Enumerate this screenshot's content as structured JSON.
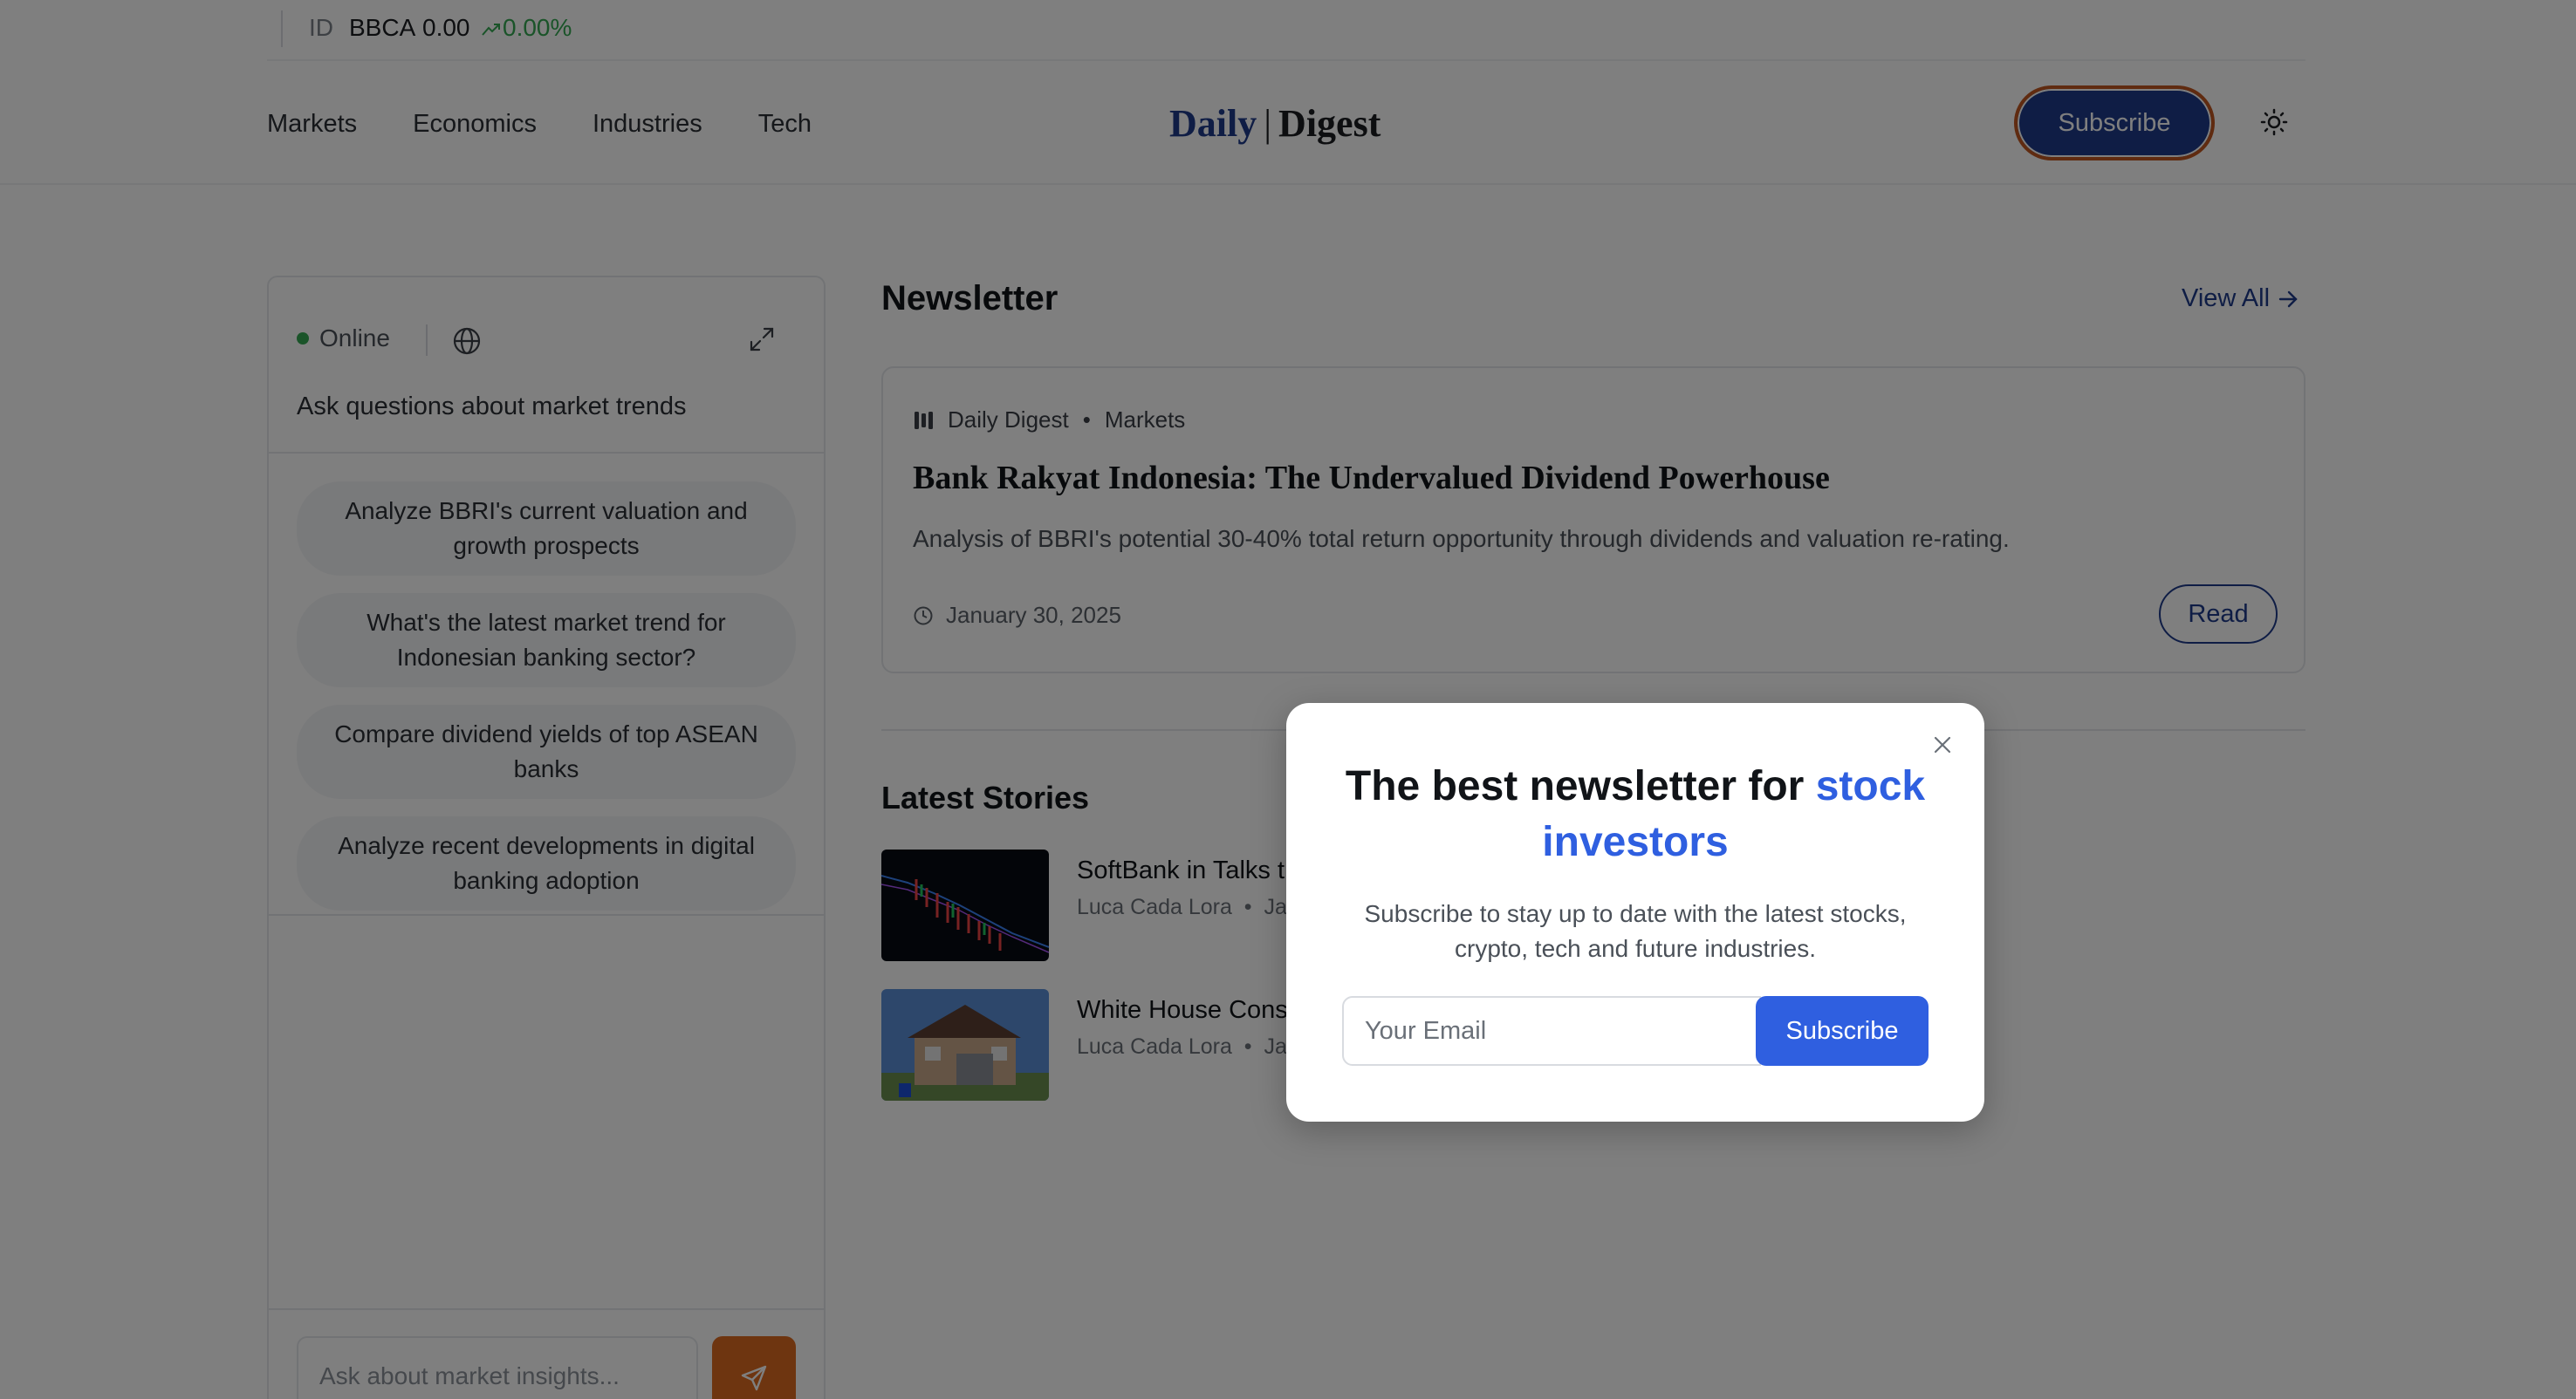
{
  "ticker": {
    "country": "ID",
    "symbol": "BBCA",
    "value": "0.00",
    "change": "0.00%",
    "change_color": "#35a853"
  },
  "header": {
    "nav": [
      "Markets",
      "Economics",
      "Industries",
      "Tech"
    ],
    "brand_part1": "Daily",
    "brand_sep": "|",
    "brand_part2": "Digest",
    "subscribe_label": "Subscribe",
    "theme_icon": "sun-icon",
    "brand_color": "#1e3a8a",
    "accent_outline": "#c05621"
  },
  "chat": {
    "status": "Online",
    "status_color": "#35a853",
    "prompt": "Ask questions about market trends",
    "suggestions": [
      "Analyze BBRI's current valuation and growth prospects",
      "What's the latest market trend for Indonesian banking sector?",
      "Compare dividend yields of top ASEAN banks",
      "Analyze recent developments in digital banking adoption"
    ],
    "input_placeholder": "Ask about market insights...",
    "send_color": "#dd6b20"
  },
  "newsletter": {
    "section_title": "Newsletter",
    "view_all": "View All",
    "card": {
      "publisher": "Daily Digest",
      "category": "Markets",
      "title": "Bank Rakyat Indonesia: The Undervalued Dividend Powerhouse",
      "description": "Analysis of BBRI's potential 30-40% total return opportunity through dividends and valuation re-rating.",
      "date": "January 30, 2025",
      "read_label": "Read"
    }
  },
  "latest": {
    "section_title": "Latest Stories",
    "stories": [
      {
        "title": "SoftBank in Talks t",
        "author": "Luca Cada Lora",
        "date_fragment": "Ja"
      },
      {
        "title": "White House Cons",
        "author": "Luca Cada Lora",
        "date_fragment": "Ja"
      }
    ]
  },
  "modal": {
    "title_prefix": "The best newsletter for",
    "title_highlight": "stock investors",
    "subtitle": "Subscribe to stay up to date with the latest stocks, crypto, tech and future industries.",
    "email_placeholder": "Your Email",
    "subscribe_label": "Subscribe",
    "highlight_color": "#2f5fe0"
  }
}
